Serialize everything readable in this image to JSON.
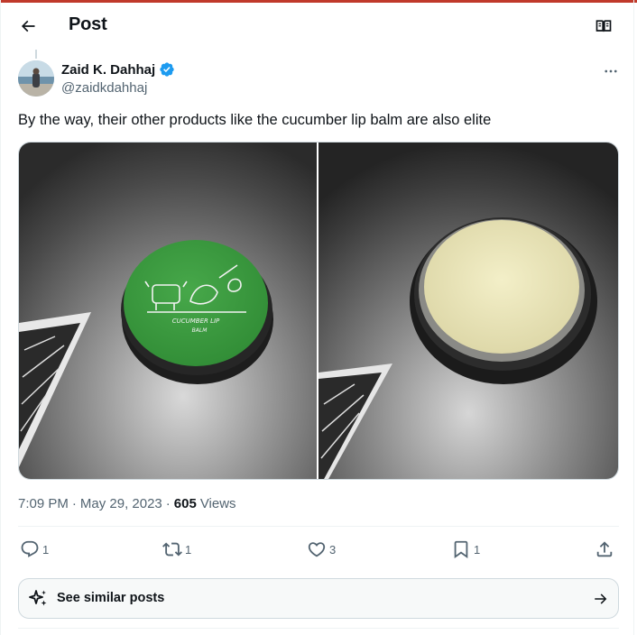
{
  "header": {
    "title": "Post",
    "back_icon": "arrow-left-icon",
    "reader_icon": "open-book-icon"
  },
  "post": {
    "author_name": "Zaid K. Dahhaj",
    "handle": "@zaidkdahhaj",
    "verified": true,
    "text": "By the way, their other products like the cucumber lip balm are also elite",
    "time": "7:09 PM",
    "date": "May 29, 2023",
    "separator": "·",
    "views_count": "605",
    "views_label": "Views"
  },
  "media": {
    "photos": [
      {
        "lid_text_line1": "CUCUMBER LIP",
        "lid_text_line2": "BALM"
      },
      {}
    ]
  },
  "actions": {
    "reply_count": "1",
    "repost_count": "1",
    "like_count": "3",
    "bookmark_count": "1"
  },
  "similar": {
    "label": "See similar posts"
  },
  "colors": {
    "accent": "#1d9bf0",
    "text": "#0f1419",
    "secondary": "#536471",
    "border": "#cfd9de",
    "lid_green": "#3a9a3e"
  }
}
